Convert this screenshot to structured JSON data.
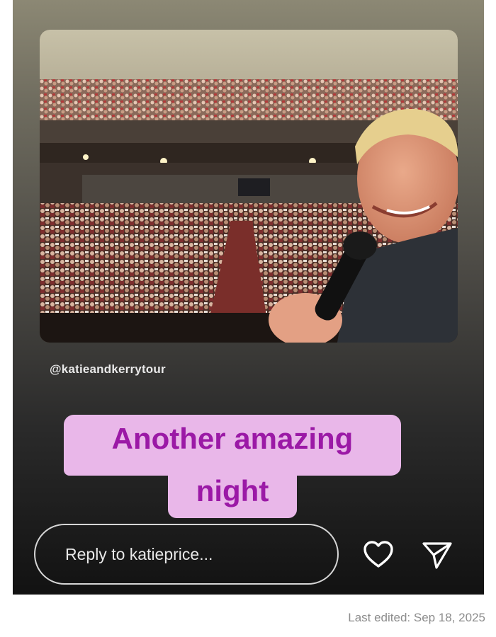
{
  "story": {
    "photo_alt": "",
    "handle": "@katieandkerrytour",
    "caption_line1": "Another amazing",
    "caption_line2": "night",
    "reply_placeholder": "Reply to katieprice...",
    "like_icon": "heart-icon",
    "share_icon": "send-icon"
  },
  "footer": {
    "last_edited": "Last edited: Sep 18, 2025"
  },
  "colors": {
    "caption_bg": "#e9b7e9",
    "caption_text": "#9b19a6"
  }
}
